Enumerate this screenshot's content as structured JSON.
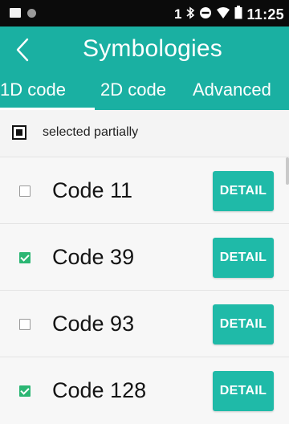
{
  "status_bar": {
    "time": "11:25",
    "sim_label": "1",
    "icons": [
      "notification-square-icon",
      "notification-dot-icon",
      "bluetooth-icon",
      "do-not-disturb-icon",
      "wifi-icon",
      "battery-icon"
    ]
  },
  "appbar": {
    "title": "Symbologies",
    "back_icon": "chevron-left-icon"
  },
  "tabs": [
    {
      "label": "1D code",
      "selected": true
    },
    {
      "label": "2D code",
      "selected": false
    },
    {
      "label": "Advanced",
      "selected": false
    }
  ],
  "partial": {
    "label": "selected partially"
  },
  "rows": [
    {
      "name": "Code 11",
      "checked": false,
      "button": "DETAIL"
    },
    {
      "name": "Code 39",
      "checked": true,
      "button": "DETAIL"
    },
    {
      "name": "Code 93",
      "checked": false,
      "button": "DETAIL"
    },
    {
      "name": "Code 128",
      "checked": true,
      "button": "DETAIL"
    }
  ],
  "colors": {
    "accent": "#1ab0a2",
    "button": "#1fbaa8",
    "check": "#2bb673"
  }
}
